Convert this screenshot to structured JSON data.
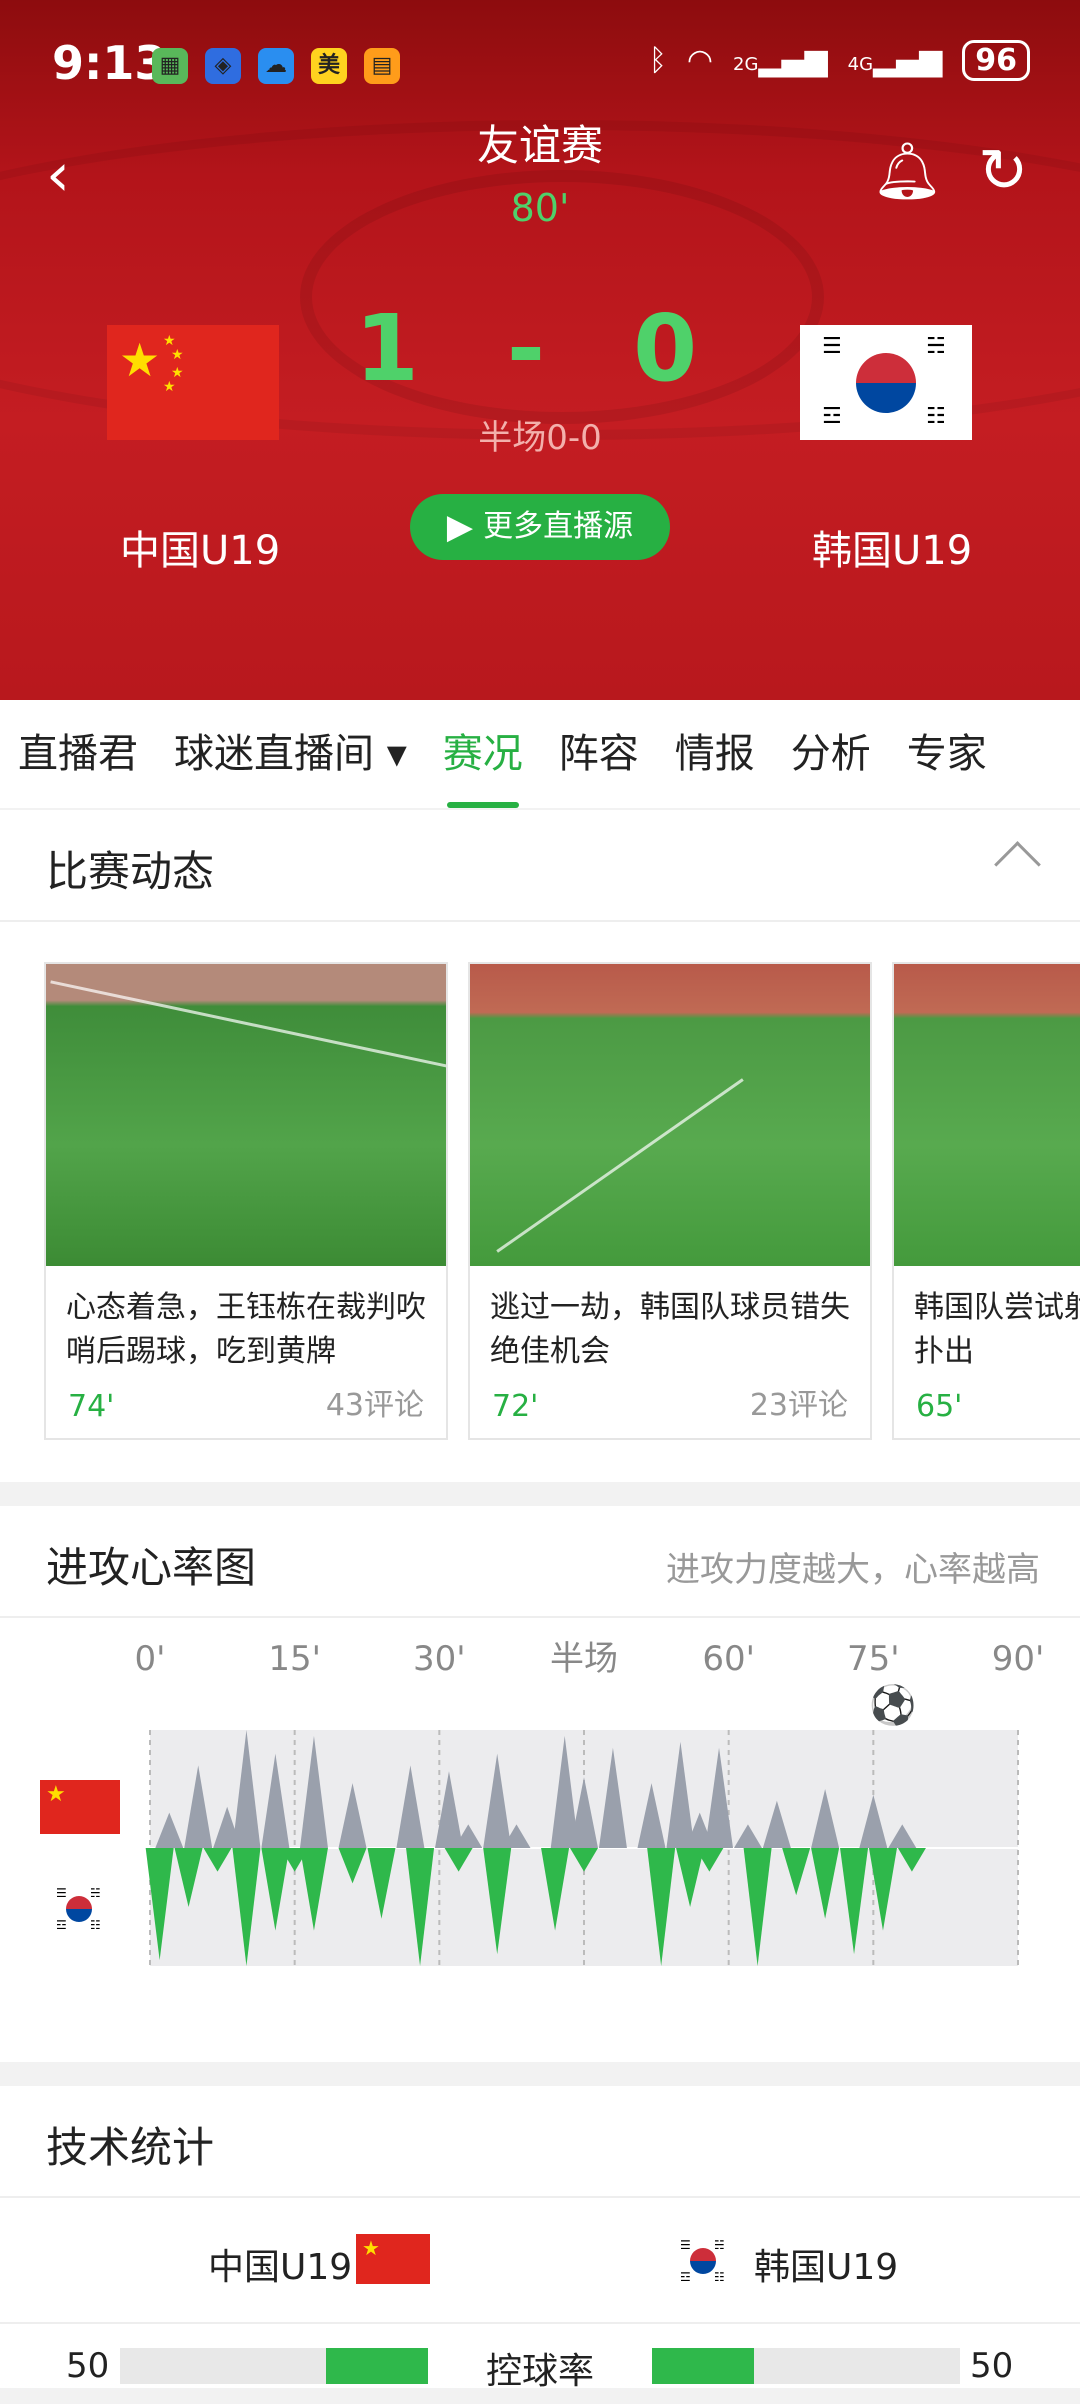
{
  "status_bar": {
    "time": "9:13",
    "apps": [
      {
        "icon": "sim-app-icon",
        "glyph": "▦",
        "color": "#59b85a"
      },
      {
        "icon": "shield-app-icon",
        "glyph": "◈",
        "color": "#2f6de0"
      },
      {
        "icon": "weather-app-icon",
        "glyph": "☁",
        "color": "#2a8ef0"
      },
      {
        "icon": "meituan-app-icon",
        "glyph": "美",
        "color": "#ffd21f"
      },
      {
        "icon": "app-icon",
        "glyph": "▤",
        "color": "#ff9c1a"
      }
    ],
    "network_2g": "2G",
    "network_4g": "4G",
    "battery": "96"
  },
  "match": {
    "league": "友谊赛",
    "minute": "80'",
    "home_team": "中国U19",
    "away_team": "韩国U19",
    "score": "1 - 0",
    "halftime": "半场0-0",
    "more_sources_label": "更多直播源"
  },
  "tabs": [
    {
      "label": "直播君",
      "active": false
    },
    {
      "label": "球迷直播间 ▾",
      "active": false
    },
    {
      "label": "赛况",
      "active": true
    },
    {
      "label": "阵容",
      "active": false
    },
    {
      "label": "情报",
      "active": false
    },
    {
      "label": "分析",
      "active": false
    },
    {
      "label": "专家",
      "active": false
    }
  ],
  "match_events": {
    "title": "比赛动态",
    "cards": [
      {
        "text": "心态着急，王钰栋在裁判吹哨后踢球，吃到黄牌",
        "minute": "74'",
        "comments": "43评论"
      },
      {
        "text": "逃过一劫，韩国队球员错失绝佳机会",
        "minute": "72'",
        "comments": "23评论"
      },
      {
        "text": "韩国队尝试射门，门将将球扑出",
        "minute": "65'",
        "comments": ""
      }
    ]
  },
  "momentum": {
    "title": "进攻心率图",
    "subtitle": "进攻力度越大，心率越高",
    "ticks": [
      "0'",
      "15'",
      "30'",
      "半场",
      "60'",
      "75'",
      "90'"
    ],
    "goal_minute": 77,
    "colors": {
      "home": "#9aa0ac",
      "away": "#2fb84b"
    },
    "home_peaks": [
      [
        2,
        0.3
      ],
      [
        5,
        0.7
      ],
      [
        8,
        0.35
      ],
      [
        10,
        1.0
      ],
      [
        13,
        0.8
      ],
      [
        17,
        0.95
      ],
      [
        21,
        0.55
      ],
      [
        27,
        0.7
      ],
      [
        31,
        0.65
      ],
      [
        33,
        0.2
      ],
      [
        36,
        0.8
      ],
      [
        38,
        0.2
      ],
      [
        43,
        0.95
      ],
      [
        45,
        0.6
      ],
      [
        48,
        0.85
      ],
      [
        52,
        0.55
      ],
      [
        55,
        0.9
      ],
      [
        57,
        0.3
      ],
      [
        59,
        0.85
      ],
      [
        62,
        0.2
      ],
      [
        65,
        0.4
      ],
      [
        70,
        0.5
      ],
      [
        75,
        0.45
      ],
      [
        78,
        0.2
      ]
    ],
    "away_peaks": [
      [
        1,
        0.95
      ],
      [
        4,
        0.5
      ],
      [
        7,
        0.2
      ],
      [
        10,
        1.0
      ],
      [
        13,
        0.7
      ],
      [
        15,
        0.2
      ],
      [
        17,
        0.7
      ],
      [
        21,
        0.3
      ],
      [
        24,
        0.6
      ],
      [
        28,
        1.0
      ],
      [
        32,
        0.2
      ],
      [
        36,
        0.9
      ],
      [
        42,
        0.7
      ],
      [
        45,
        0.2
      ],
      [
        53,
        1.0
      ],
      [
        56,
        0.5
      ],
      [
        58,
        0.2
      ],
      [
        63,
        1.0
      ],
      [
        67,
        0.4
      ],
      [
        70,
        0.6
      ],
      [
        73,
        0.9
      ],
      [
        76,
        0.7
      ],
      [
        79,
        0.2
      ]
    ]
  },
  "tech_stats": {
    "title": "技术统计",
    "home_team": "中国U19",
    "away_team": "韩国U19",
    "rows": [
      {
        "label": "控球率",
        "home": "50",
        "away": "50",
        "home_fraction": 0.5,
        "away_fraction": 0.5
      }
    ]
  }
}
